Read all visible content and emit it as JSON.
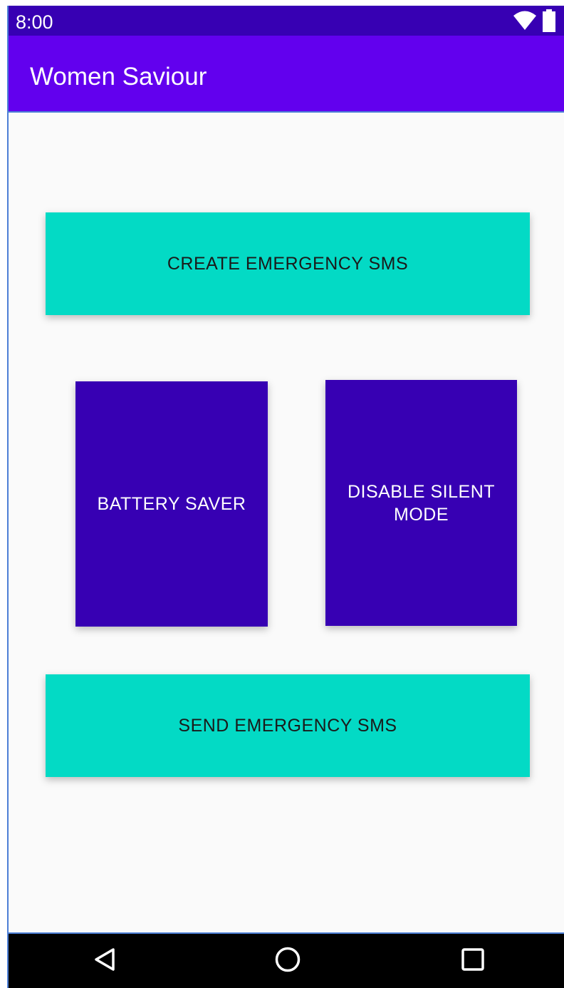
{
  "status_bar": {
    "time": "8:00",
    "icons": [
      "wifi-icon",
      "battery-icon"
    ]
  },
  "app_bar": {
    "title": "Women Saviour",
    "color": "#6200ee"
  },
  "buttons": {
    "create_sms": "CREATE EMERGENCY SMS",
    "battery_saver": "BATTERY SAVER",
    "disable_silent": "DISABLE SILENT MODE",
    "send_sms": "SEND EMERGENCY SMS"
  },
  "colors": {
    "status_bar": "#3700b3",
    "primary": "#6200ee",
    "accent_teal": "#03dac5",
    "button_indigo": "#3700b3"
  },
  "nav_bar": {
    "icons": [
      "back-icon",
      "home-icon",
      "recent-apps-icon"
    ]
  }
}
